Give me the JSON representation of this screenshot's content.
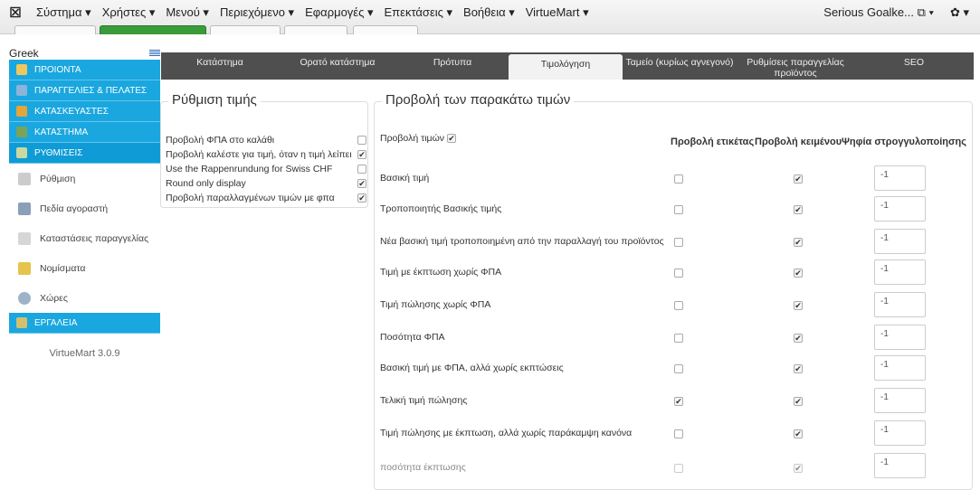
{
  "menubar": {
    "logo": "☒",
    "items": [
      "Σύστημα ▾",
      "Χρήστες ▾",
      "Μενού ▾",
      "Περιεχόμενο ▾",
      "Εφαρμογές ▾",
      "Επεκτάσεις ▾",
      "Βοήθεια ▾",
      "VirtueMart ▾"
    ],
    "user": "Serious Goalke... ⧉ ▾",
    "settings": "✿ ▾"
  },
  "sidebar": {
    "language": "Greek",
    "primary": [
      "ΠΡΟΙΟΝΤΑ",
      "ΠΑΡΑΓΓΕΛΙΕΣ & ΠΕΛΑΤΕΣ",
      "ΚΑΤΑΣΚΕΥΑΣΤΕΣ",
      "ΚΑΤΑΣΤΗΜΑ",
      "ΡΥΘΜΙΣΕΙΣ"
    ],
    "sub": [
      "Ρύθμιση",
      "Πεδία αγοραστή",
      "Καταστάσεις παραγγελίας",
      "Νομίσματα",
      "Χώρες"
    ],
    "tools": "ΕΡΓΑΛΕΙΑ",
    "version": "VirtueMart 3.0.9"
  },
  "tabs": [
    "Κατάστημα",
    "Ορατό κατάστημα",
    "Πρότυπα",
    "Τιμολόγηση",
    "Ταμείο (κυρίως αγνεγονό)",
    "Ρυθμίσεις παραγγελίας προϊόντος",
    "SEO"
  ],
  "pricing": {
    "legend": "Ρύθμιση τιμής",
    "options": [
      {
        "label": "Προβολή ΦΠΑ στο καλάθι",
        "checked": false
      },
      {
        "label": "Προβολή καλέστε για τιμή, όταν η τιμή λείπει",
        "checked": true
      },
      {
        "label": "Use the Rappenrundung for Swiss CHF",
        "checked": false
      },
      {
        "label": "Round only display",
        "checked": true
      },
      {
        "label": "Προβολή παραλλαγμένων τιμών με φπα",
        "checked": true
      }
    ]
  },
  "display": {
    "legend": "Προβολή των παρακάτω τιμών",
    "show_prices_label": "Προβολή τιμών",
    "show_prices_checked": true,
    "headers": {
      "label": "Προβολή ετικέτας",
      "text": "Προβολή κειμένου",
      "digits": "Ψηφία στρογγυλοποίησης"
    },
    "rows": [
      {
        "name": "Βασική τιμή",
        "label": false,
        "text": true,
        "digits": "-1"
      },
      {
        "name": "Τροποποιητής Βασικής τιμής",
        "label": false,
        "text": true,
        "digits": "-1"
      },
      {
        "name": "Νέα βασική τιμή τροποποιημένη από την παραλλαγή του προϊόντος",
        "label": false,
        "text": true,
        "digits": "-1"
      },
      {
        "name": "Τιμή με έκπτωση χωρίς ΦΠΑ",
        "label": false,
        "text": true,
        "digits": "-1"
      },
      {
        "name": "Τιμή πώλησης χωρίς ΦΠΑ",
        "label": false,
        "text": true,
        "digits": "-1"
      },
      {
        "name": "Ποσότητα ΦΠΑ",
        "label": false,
        "text": true,
        "digits": "-1"
      },
      {
        "name": "Βασική τιμή με ΦΠΑ, αλλά χωρίς εκπτώσεις",
        "label": false,
        "text": true,
        "digits": "-1"
      },
      {
        "name": "Τελική τιμή πώλησης",
        "label": true,
        "text": true,
        "digits": "-1"
      },
      {
        "name": "Τιμή πώλησης με έκπτωση, αλλά χωρίς παράκαμψη κανόνα",
        "label": false,
        "text": true,
        "digits": "-1"
      },
      {
        "name": "ποσότητα έκπτωσης",
        "label": false,
        "text": true,
        "digits": "-1"
      }
    ]
  }
}
